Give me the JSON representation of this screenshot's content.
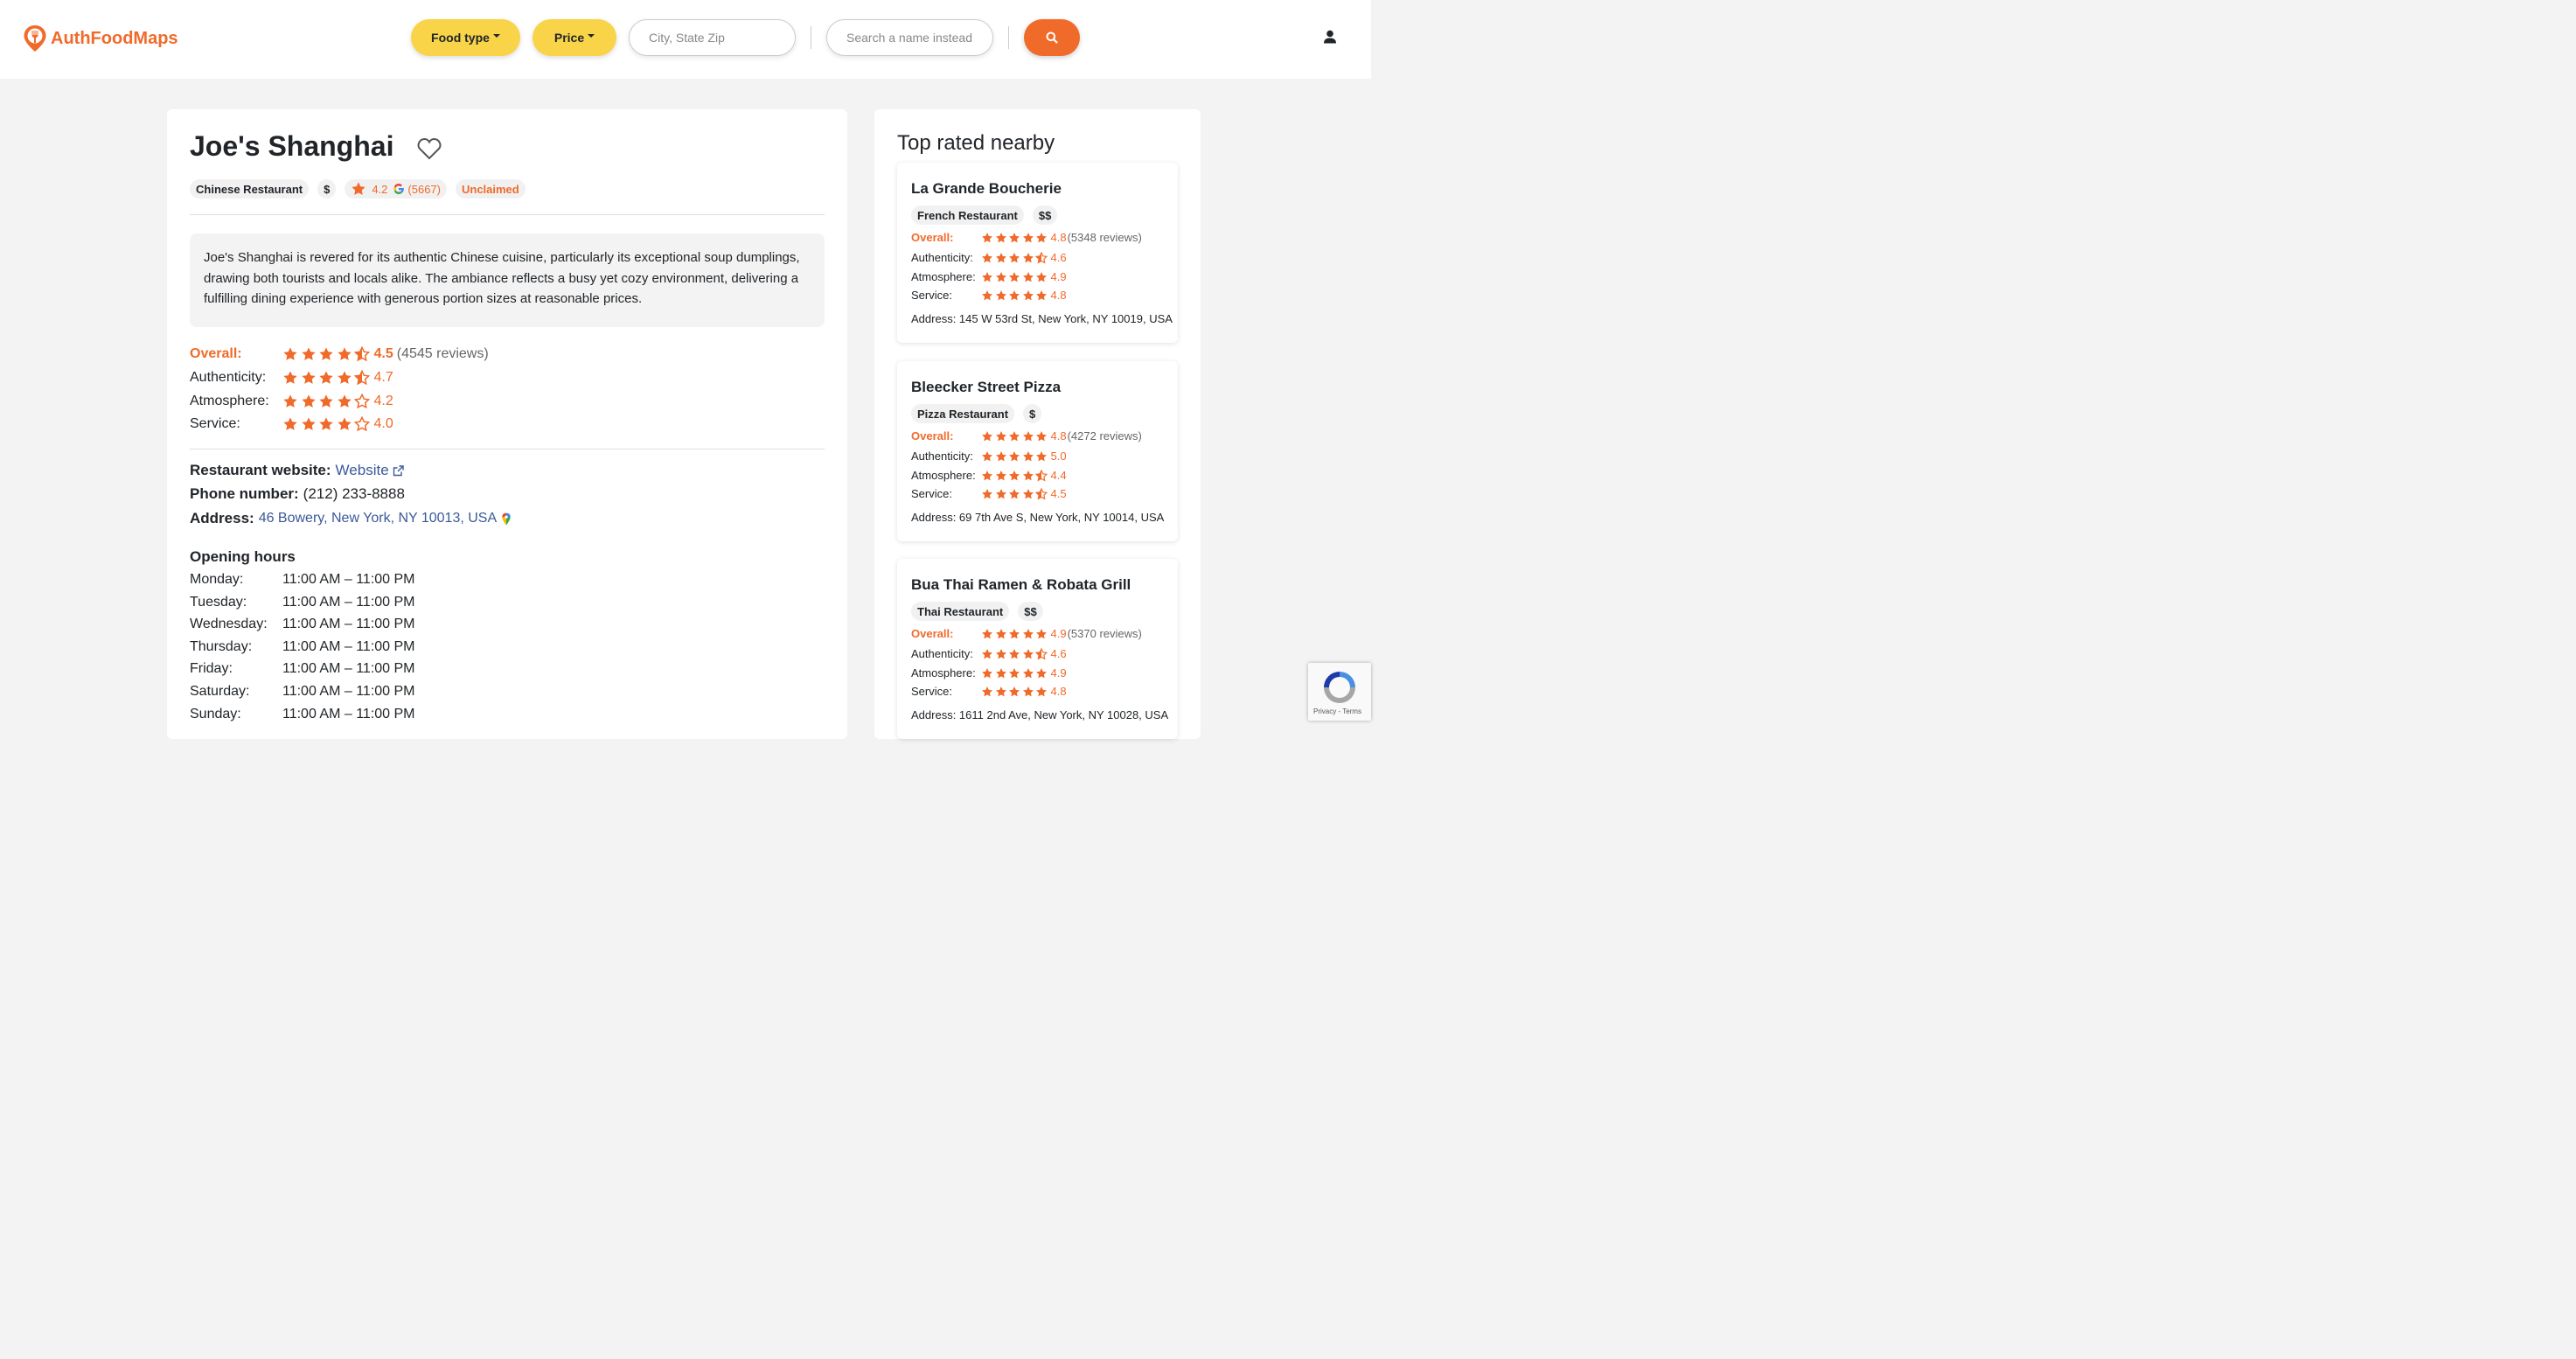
{
  "brand": {
    "name": "AuthFoodMaps",
    "color": "#f06a2a"
  },
  "header": {
    "food_type_label": "Food type",
    "price_label": "Price",
    "city_placeholder": "City, State Zip",
    "name_placeholder": "Search a name instead",
    "search_icon": "search-icon",
    "user_icon": "user-icon"
  },
  "restaurant": {
    "name": "Joe's Shanghai",
    "category": "Chinese Restaurant",
    "price": "$",
    "google_rating": "4.2",
    "google_count": "(5667)",
    "claim_status": "Unclaimed",
    "description": "Joe's Shanghai is revered for its authentic Chinese cuisine, particularly its exceptional soup dumplings, drawing both tourists and locals alike. The ambiance reflects a busy yet cozy environment, delivering a fulfilling dining experience with generous portion sizes at reasonable prices.",
    "ratings": [
      {
        "label": "Overall:",
        "value": "4.5",
        "stars": 4.5,
        "count": "(4545 reviews)"
      },
      {
        "label": "Authenticity:",
        "value": "4.7",
        "stars": 4.5,
        "count": ""
      },
      {
        "label": "Atmosphere:",
        "value": "4.2",
        "stars": 4,
        "count": ""
      },
      {
        "label": "Service:",
        "value": "4.0",
        "stars": 4,
        "count": ""
      }
    ],
    "website_key": "Restaurant website:",
    "website_label": "Website",
    "phone_key": "Phone number:",
    "phone": "(212) 233-8888",
    "address_key": "Address:",
    "address": "46 Bowery, New York, NY 10013, USA",
    "hours_title": "Opening hours",
    "hours": [
      {
        "day": "Monday:",
        "time": "11:00 AM – 11:00 PM"
      },
      {
        "day": "Tuesday:",
        "time": "11:00 AM – 11:00 PM"
      },
      {
        "day": "Wednesday:",
        "time": "11:00 AM – 11:00 PM"
      },
      {
        "day": "Thursday:",
        "time": "11:00 AM – 11:00 PM"
      },
      {
        "day": "Friday:",
        "time": "11:00 AM – 11:00 PM"
      },
      {
        "day": "Saturday:",
        "time": "11:00 AM – 11:00 PM"
      },
      {
        "day": "Sunday:",
        "time": "11:00 AM – 11:00 PM"
      }
    ]
  },
  "nearby": {
    "title": "Top rated nearby",
    "items": [
      {
        "name": "La Grande Boucherie",
        "category": "French Restaurant",
        "price": "$$",
        "ratings": [
          {
            "label": "Overall:",
            "value": "4.8",
            "stars": 5,
            "count": "(5348 reviews)"
          },
          {
            "label": "Authenticity:",
            "value": "4.6",
            "stars": 4.5,
            "count": ""
          },
          {
            "label": "Atmosphere:",
            "value": "4.9",
            "stars": 5,
            "count": ""
          },
          {
            "label": "Service:",
            "value": "4.8",
            "stars": 5,
            "count": ""
          }
        ],
        "address": "Address: 145 W 53rd St, New York, NY 10019, USA"
      },
      {
        "name": "Bleecker Street Pizza",
        "category": "Pizza Restaurant",
        "price": "$",
        "ratings": [
          {
            "label": "Overall:",
            "value": "4.8",
            "stars": 5,
            "count": "(4272 reviews)"
          },
          {
            "label": "Authenticity:",
            "value": "5.0",
            "stars": 5,
            "count": ""
          },
          {
            "label": "Atmosphere:",
            "value": "4.4",
            "stars": 4.5,
            "count": ""
          },
          {
            "label": "Service:",
            "value": "4.5",
            "stars": 4.5,
            "count": ""
          }
        ],
        "address": "Address: 69 7th Ave S, New York, NY 10014, USA"
      },
      {
        "name": "Bua Thai Ramen & Robata Grill",
        "category": "Thai Restaurant",
        "price": "$$",
        "ratings": [
          {
            "label": "Overall:",
            "value": "4.9",
            "stars": 5,
            "count": "(5370 reviews)"
          },
          {
            "label": "Authenticity:",
            "value": "4.6",
            "stars": 4.5,
            "count": ""
          },
          {
            "label": "Atmosphere:",
            "value": "4.9",
            "stars": 5,
            "count": ""
          },
          {
            "label": "Service:",
            "value": "4.8",
            "stars": 5,
            "count": ""
          }
        ],
        "address": "Address: 1611 2nd Ave, New York, NY 10028, USA"
      }
    ]
  },
  "recaptcha": {
    "links": "Privacy - Terms"
  }
}
